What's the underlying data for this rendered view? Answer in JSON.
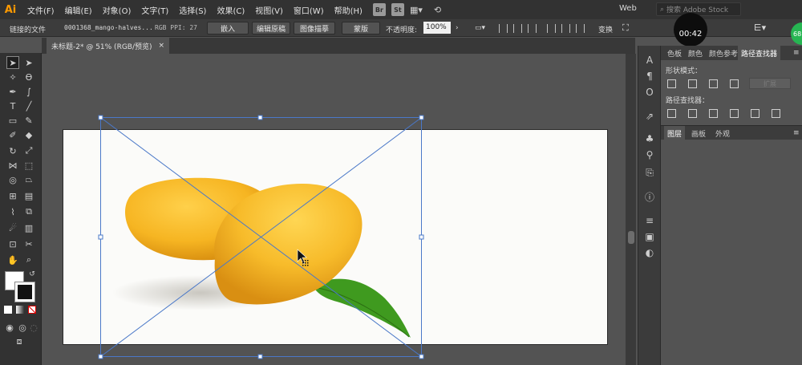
{
  "app": {
    "logo": "Ai"
  },
  "menu": [
    "文件(F)",
    "编辑(E)",
    "对象(O)",
    "文字(T)",
    "选择(S)",
    "效果(C)",
    "视图(V)",
    "窗口(W)",
    "帮助(H)"
  ],
  "menubar_buttons": [
    "Br",
    "St"
  ],
  "workspace": "Web",
  "search_placeholder": "搜索 Adobe Stock",
  "control": {
    "label": "链接的文件",
    "filename": "0001368_mango-halves...",
    "info": "RGB  PPI: 27",
    "embed": "嵌入",
    "edit_original": "编辑原稿",
    "image_trace": "图像描摹",
    "mask": "蒙版",
    "opacity_label": "不透明度:",
    "opacity_value": "100%",
    "transform": "变换"
  },
  "timer": "00:42",
  "badge": "68",
  "doc_tab": {
    "title": "未标题-2* @ 51% (RGB/预览)",
    "close": "×"
  },
  "panel": {
    "tabs": [
      "色板",
      "颜色",
      "颜色参考",
      "路径查找器"
    ],
    "shape_modes": "形状模式：",
    "expand": "扩展",
    "pathfinders": "路径查找器：",
    "layers_tabs": [
      "图层",
      "画板",
      "外观"
    ]
  },
  "colors": {
    "accent": "#ff9a00",
    "badge": "#26b552",
    "selection": "#4a78c8"
  },
  "icons": [
    "selection-icon",
    "direct-selection-icon",
    "magic-wand-icon",
    "lasso-icon",
    "pen-icon",
    "curvature-icon",
    "type-icon",
    "line-icon",
    "rectangle-icon",
    "paintbrush-icon",
    "shaper-icon",
    "eraser-icon",
    "rotate-icon",
    "scale-icon",
    "width-icon",
    "free-transform-icon",
    "shape-builder-icon",
    "perspective-icon",
    "mesh-icon",
    "gradient-icon",
    "eyedropper-icon",
    "blend-icon",
    "symbol-sprayer-icon",
    "column-graph-icon",
    "artboard-icon",
    "slice-icon",
    "hand-icon",
    "zoom-icon"
  ]
}
